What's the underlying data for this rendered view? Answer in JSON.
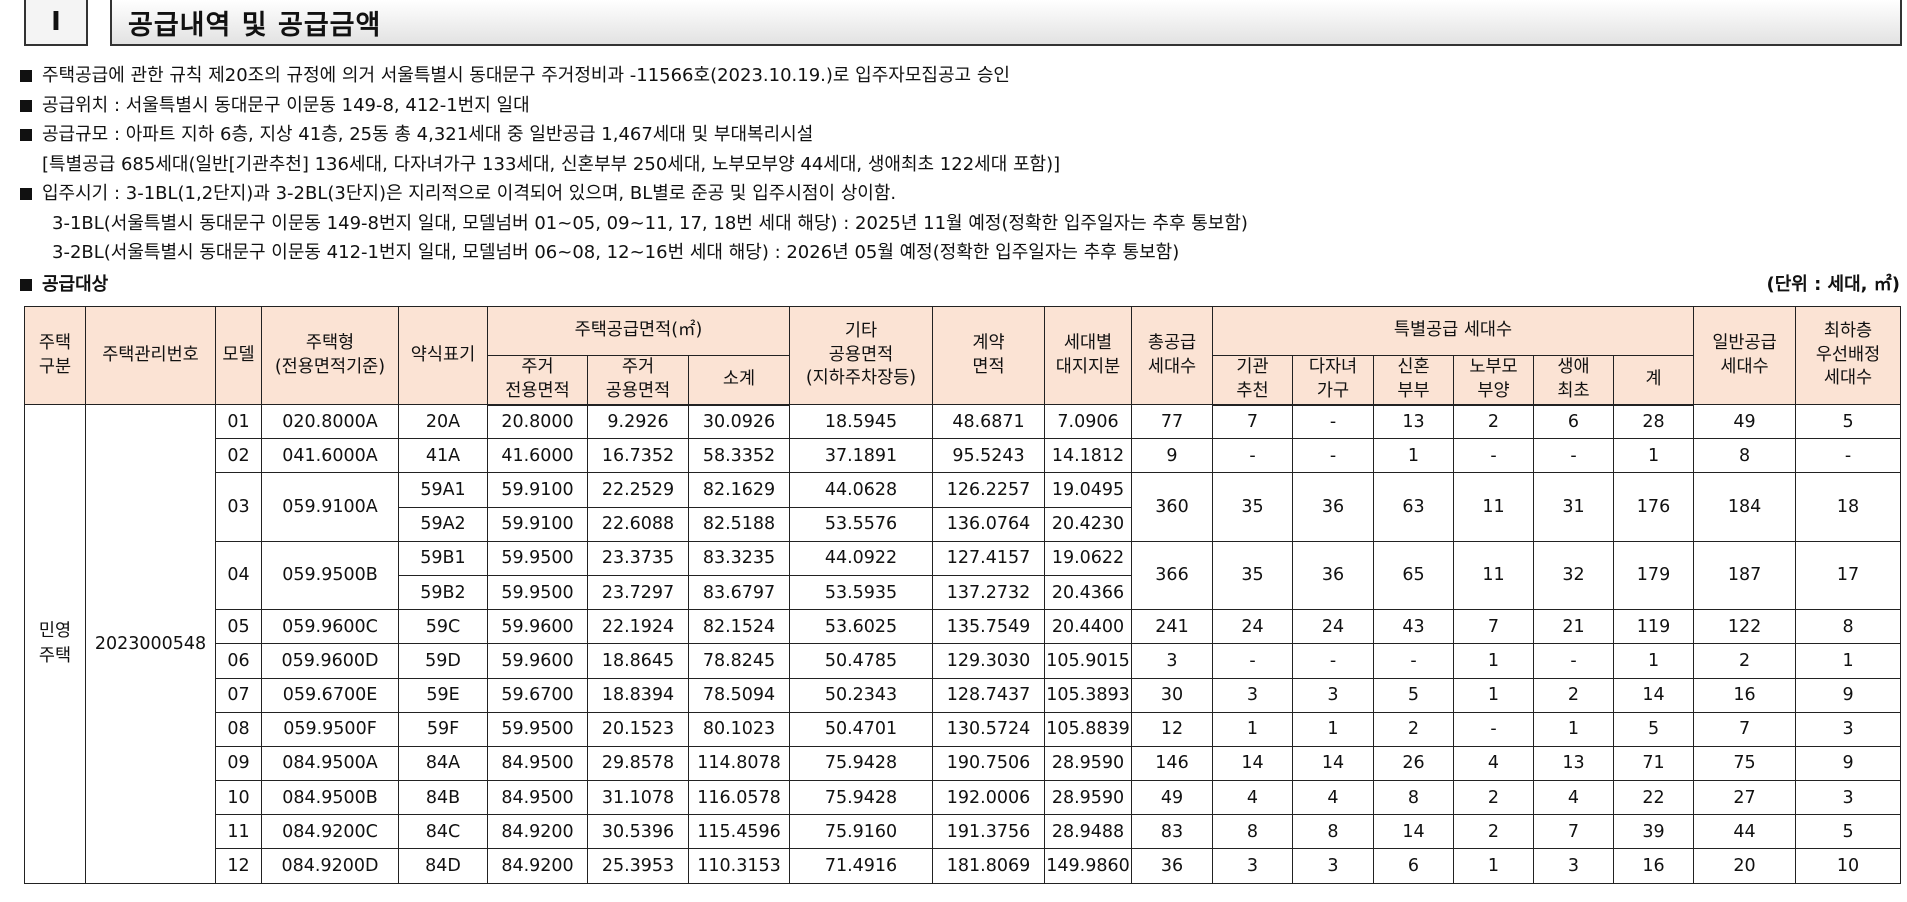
{
  "header": {
    "section_number": "I",
    "title": "공급내역 및 공급금액"
  },
  "notes": [
    {
      "bullet": true,
      "indent": 0,
      "text": "주택공급에 관한 규칙 제20조의 규정에 의거 서울특별시 동대문구 주거정비과 -11566호(2023.10.19.)로 입주자모집공고 승인"
    },
    {
      "bullet": true,
      "indent": 0,
      "text": "공급위치 : 서울특별시 동대문구 이문동 149-8, 412-1번지 일대"
    },
    {
      "bullet": true,
      "indent": 0,
      "text": "공급규모 : 아파트 지하 6층, 지상 41층, 25동 총 4,321세대 중 일반공급 1,467세대 및 부대복리시설"
    },
    {
      "bullet": false,
      "indent": 1,
      "text": "[특별공급 685세대(일반[기관추천] 136세대, 다자녀가구 133세대, 신혼부부 250세대, 노부모부양 44세대, 생애최초 122세대 포함)]"
    },
    {
      "bullet": true,
      "indent": 0,
      "text": "입주시기 :    3-1BL(1,2단지)과 3-2BL(3단지)은 지리적으로 이격되어 있으며, BL별로 준공 및 입주시점이 상이함."
    },
    {
      "bullet": false,
      "indent": 2,
      "text": "3-1BL(서울특별시 동대문구 이문동 149-8번지 일대, 모델넘버 01~05, 09~11, 17, 18번 세대 해당) : 2025년 11월 예정(정확한 입주일자는 추후 통보함)"
    },
    {
      "bullet": false,
      "indent": 2,
      "text": "3-2BL(서울특별시 동대문구 이문동 412-1번지 일대, 모델넘버 06~08, 12~16번 세대 해당) : 2026년 05월 예정(정확한 입주일자는 추후 통보함)"
    }
  ],
  "section": {
    "label": "공급대상",
    "unit": "(단위 : 세대, ㎡)"
  },
  "table": {
    "headers": {
      "house_type_group": "주택\n구분",
      "mgmt_no": "주택관리번호",
      "model": "모델",
      "housing_type": "주택형\n(전용면적기준)",
      "short_code": "약식표기",
      "supply_area": "주택공급면적(㎡)",
      "private_area": "주거\n전용면적",
      "common_area": "주거\n공용면적",
      "subtotal": "소계",
      "other_common": "기타\n공용면적\n(지하주차장등)",
      "contract_area": "계약\n면적",
      "land_share": "세대별\n대지지분",
      "total_supply": "총공급\n세대수",
      "special_supply": "특별공급 세대수",
      "institution": "기관\n추천",
      "multi_child": "다자녀\n가구",
      "newlywed": "신혼\n부부",
      "elderly": "노부모\n부양",
      "first_time": "생애\n최초",
      "special_total": "계",
      "general": "일반공급\n세대수",
      "lowest_floor": "최하층\n우선배정\n세대수"
    },
    "group_label": "민영\n주택",
    "mgmt_number": "2023000548",
    "rows": [
      {
        "model": "01",
        "type": "020.8000A",
        "subs": [
          [
            "20A",
            "20.8000",
            "9.2926",
            "30.0926",
            "18.5945",
            "48.6871",
            "7.0906"
          ]
        ],
        "counts": [
          "77",
          "7",
          "-",
          "13",
          "2",
          "6",
          "28",
          "49",
          "5"
        ]
      },
      {
        "model": "02",
        "type": "041.6000A",
        "subs": [
          [
            "41A",
            "41.6000",
            "16.7352",
            "58.3352",
            "37.1891",
            "95.5243",
            "14.1812"
          ]
        ],
        "counts": [
          "9",
          "-",
          "-",
          "1",
          "-",
          "-",
          "1",
          "8",
          "-"
        ]
      },
      {
        "model": "03",
        "type": "059.9100A",
        "subs": [
          [
            "59A1",
            "59.9100",
            "22.2529",
            "82.1629",
            "44.0628",
            "126.2257",
            "19.0495"
          ],
          [
            "59A2",
            "59.9100",
            "22.6088",
            "82.5188",
            "53.5576",
            "136.0764",
            "20.4230"
          ]
        ],
        "counts": [
          "360",
          "35",
          "36",
          "63",
          "11",
          "31",
          "176",
          "184",
          "18"
        ]
      },
      {
        "model": "04",
        "type": "059.9500B",
        "subs": [
          [
            "59B1",
            "59.9500",
            "23.3735",
            "83.3235",
            "44.0922",
            "127.4157",
            "19.0622"
          ],
          [
            "59B2",
            "59.9500",
            "23.7297",
            "83.6797",
            "53.5935",
            "137.2732",
            "20.4366"
          ]
        ],
        "counts": [
          "366",
          "35",
          "36",
          "65",
          "11",
          "32",
          "179",
          "187",
          "17"
        ]
      },
      {
        "model": "05",
        "type": "059.9600C",
        "subs": [
          [
            "59C",
            "59.9600",
            "22.1924",
            "82.1524",
            "53.6025",
            "135.7549",
            "20.4400"
          ]
        ],
        "counts": [
          "241",
          "24",
          "24",
          "43",
          "7",
          "21",
          "119",
          "122",
          "8"
        ]
      },
      {
        "model": "06",
        "type": "059.9600D",
        "subs": [
          [
            "59D",
            "59.9600",
            "18.8645",
            "78.8245",
            "50.4785",
            "129.3030",
            "105.9015"
          ]
        ],
        "counts": [
          "3",
          "-",
          "-",
          "-",
          "1",
          "-",
          "1",
          "2",
          "1"
        ]
      },
      {
        "model": "07",
        "type": "059.6700E",
        "subs": [
          [
            "59E",
            "59.6700",
            "18.8394",
            "78.5094",
            "50.2343",
            "128.7437",
            "105.3893"
          ]
        ],
        "counts": [
          "30",
          "3",
          "3",
          "5",
          "1",
          "2",
          "14",
          "16",
          "9"
        ]
      },
      {
        "model": "08",
        "type": "059.9500F",
        "subs": [
          [
            "59F",
            "59.9500",
            "20.1523",
            "80.1023",
            "50.4701",
            "130.5724",
            "105.8839"
          ]
        ],
        "counts": [
          "12",
          "1",
          "1",
          "2",
          "-",
          "1",
          "5",
          "7",
          "3"
        ]
      },
      {
        "model": "09",
        "type": "084.9500A",
        "subs": [
          [
            "84A",
            "84.9500",
            "29.8578",
            "114.8078",
            "75.9428",
            "190.7506",
            "28.9590"
          ]
        ],
        "counts": [
          "146",
          "14",
          "14",
          "26",
          "4",
          "13",
          "71",
          "75",
          "9"
        ]
      },
      {
        "model": "10",
        "type": "084.9500B",
        "subs": [
          [
            "84B",
            "84.9500",
            "31.1078",
            "116.0578",
            "75.9428",
            "192.0006",
            "28.9590"
          ]
        ],
        "counts": [
          "49",
          "4",
          "4",
          "8",
          "2",
          "4",
          "22",
          "27",
          "3"
        ]
      },
      {
        "model": "11",
        "type": "084.9200C",
        "subs": [
          [
            "84C",
            "84.9200",
            "30.5396",
            "115.4596",
            "75.9160",
            "191.3756",
            "28.9488"
          ]
        ],
        "counts": [
          "83",
          "8",
          "8",
          "14",
          "2",
          "7",
          "39",
          "44",
          "5"
        ]
      },
      {
        "model": "12",
        "type": "084.9200D",
        "subs": [
          [
            "84D",
            "84.9200",
            "25.3953",
            "110.3153",
            "71.4916",
            "181.8069",
            "149.9860"
          ]
        ],
        "counts": [
          "36",
          "3",
          "3",
          "6",
          "1",
          "3",
          "16",
          "20",
          "10"
        ]
      }
    ]
  }
}
